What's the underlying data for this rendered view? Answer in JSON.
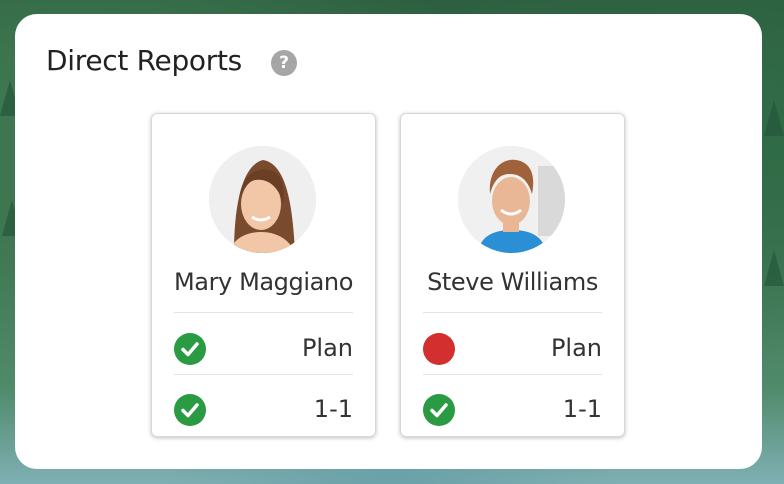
{
  "widget": {
    "title": "Direct Reports"
  },
  "reports": [
    {
      "name": "Mary Maggiano",
      "rows": [
        {
          "label": "Plan",
          "status": "check"
        },
        {
          "label": "1-1",
          "status": "check"
        }
      ]
    },
    {
      "name": "Steve Williams",
      "rows": [
        {
          "label": "Plan",
          "status": "red-dot"
        },
        {
          "label": "1-1",
          "status": "check"
        }
      ]
    }
  ],
  "colors": {
    "check": "#2a9a43",
    "alert": "#d32f2f",
    "help": "#a6a6a6"
  }
}
